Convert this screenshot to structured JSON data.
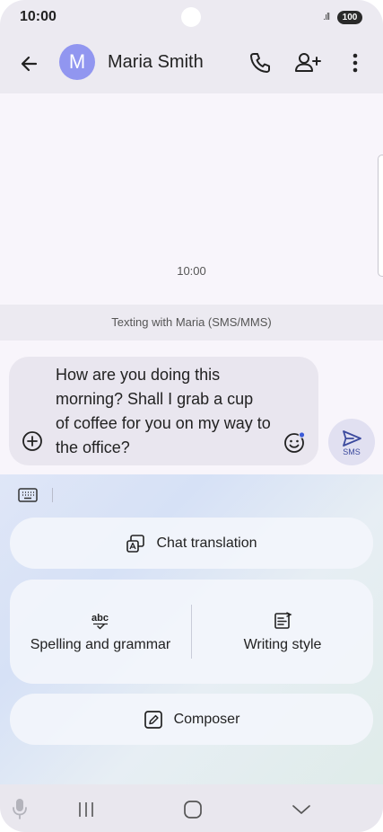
{
  "status_bar": {
    "time": "10:00",
    "signal": ".ıll",
    "battery": "100"
  },
  "header": {
    "avatar_initial": "M",
    "contact_name": "Maria Smith"
  },
  "conversation": {
    "timestamp": "10:00",
    "banner": "Texting with Maria (SMS/MMS)"
  },
  "compose": {
    "text": "How are you doing this morning? Shall I grab a cup of coffee for you on my way to the office?",
    "send_label": "SMS"
  },
  "assistant": {
    "chat_translation": "Chat translation",
    "spelling_grammar": "Spelling and grammar",
    "writing_style": "Writing style",
    "composer": "Composer"
  },
  "colors": {
    "accent": "#3c4a9e",
    "avatar": "#9196f0",
    "header_bg": "#eceaf1"
  }
}
